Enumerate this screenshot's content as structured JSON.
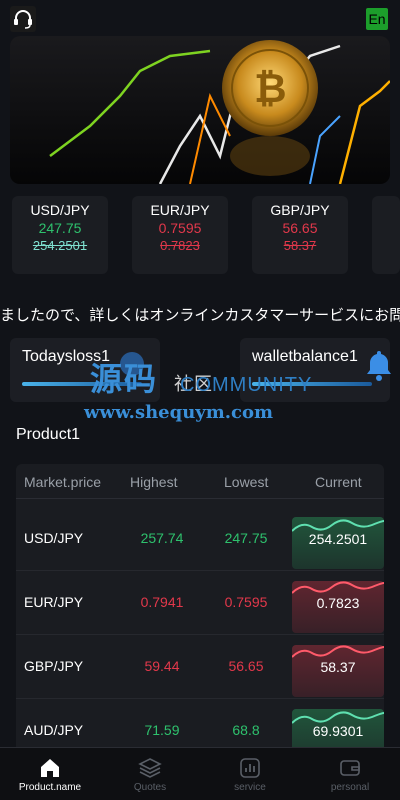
{
  "header": {
    "lang_label": "En"
  },
  "ticker_cards": [
    {
      "pair": "USD/JPY",
      "price": "247.75",
      "prev": "254.2501",
      "trend": "up"
    },
    {
      "pair": "EUR/JPY",
      "price": "0.7595",
      "prev": "0.7823",
      "trend": "down"
    },
    {
      "pair": "GBP/JPY",
      "price": "56.65",
      "prev": "58.37",
      "trend": "down"
    }
  ],
  "notice": "ましたので、詳しくはオンラインカスタマーサービスにお問い合わせください。",
  "stats": {
    "today_loss_label": "Todaysloss1",
    "wallet_label": "walletbalance1"
  },
  "watermark": {
    "cn": "源码",
    "cn2": "社区",
    "en": "COMMUNITY",
    "url": "www.shequym.com"
  },
  "product": {
    "title": "Product1",
    "headers": {
      "market": "Market.price",
      "highest": "Highest",
      "lowest": "Lowest",
      "current": "Current"
    },
    "rows": [
      {
        "pair": "USD/JPY",
        "highest": "257.74",
        "lowest": "247.75",
        "current": "254.2501",
        "trend": "up"
      },
      {
        "pair": "EUR/JPY",
        "highest": "0.7941",
        "lowest": "0.7595",
        "current": "0.7823",
        "trend": "down"
      },
      {
        "pair": "GBP/JPY",
        "highest": "59.44",
        "lowest": "56.65",
        "current": "58.37",
        "trend": "down"
      },
      {
        "pair": "AUD/JPY",
        "highest": "71.59",
        "lowest": "68.8",
        "current": "69.9301",
        "trend": "up"
      }
    ]
  },
  "tabbar": {
    "product": "Product.name",
    "quotes": "Quotes",
    "service": "service",
    "personal": "personal"
  },
  "colors": {
    "up": "#2ec16d",
    "down": "#e2384b",
    "accent": "#4ab3ea"
  }
}
